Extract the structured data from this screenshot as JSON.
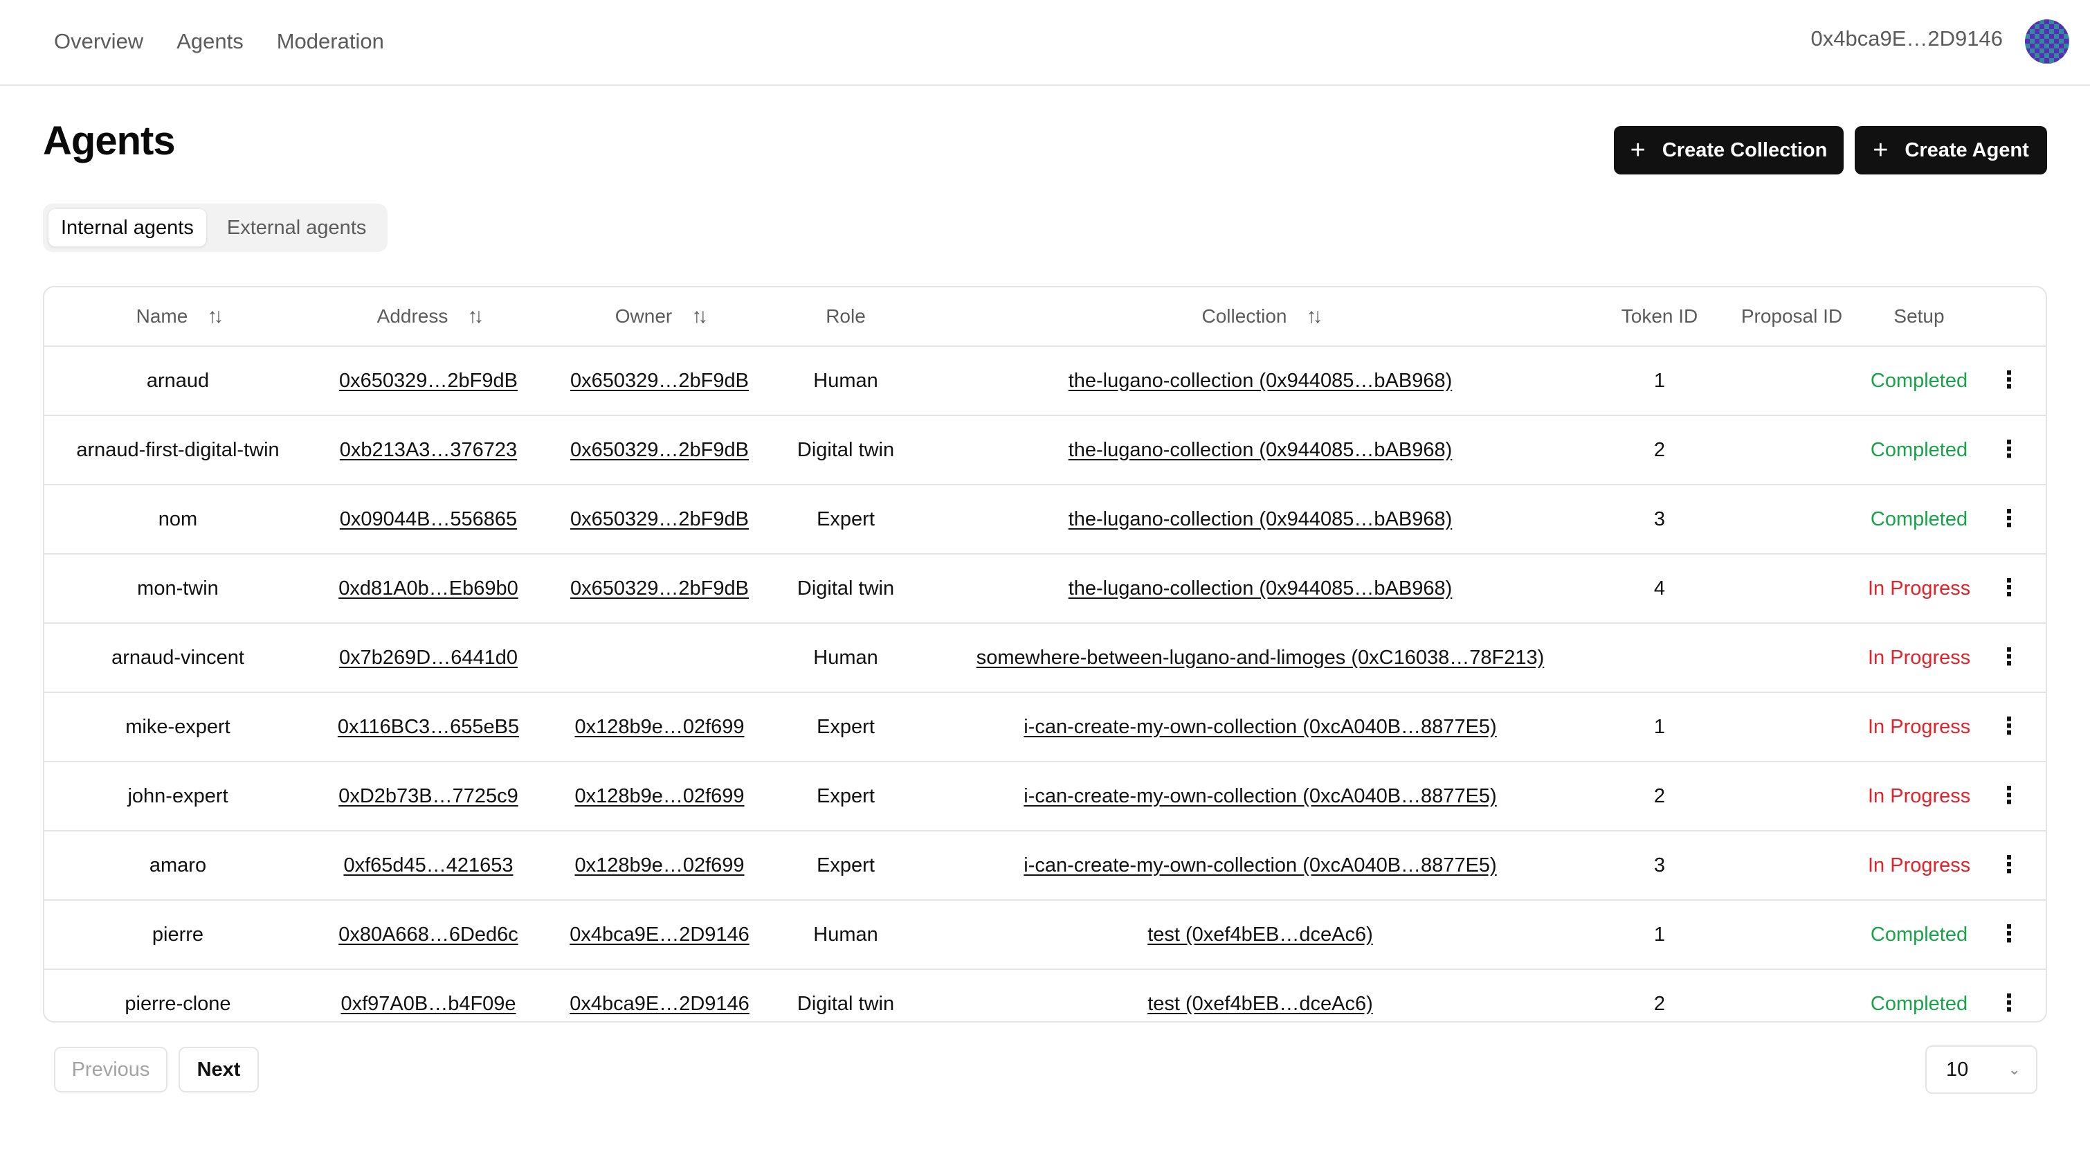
{
  "nav": {
    "items": [
      "Overview",
      "Agents",
      "Moderation"
    ]
  },
  "wallet": {
    "address": "0x4bca9E…2D9146"
  },
  "page": {
    "title": "Agents",
    "create_collection_label": "Create Collection",
    "create_agent_label": "Create Agent"
  },
  "tabs": {
    "internal": "Internal agents",
    "external": "External agents",
    "active": "Internal agents"
  },
  "table": {
    "columns": [
      "Name",
      "Address",
      "Owner",
      "Role",
      "Collection",
      "Token ID",
      "Proposal ID",
      "Setup"
    ],
    "sortable_columns": [
      "Name",
      "Address",
      "Owner",
      "Collection"
    ],
    "rows": [
      {
        "name": "arnaud",
        "address": "0x650329…2bF9dB",
        "owner": "0x650329…2bF9dB",
        "role": "Human",
        "collection": "the-lugano-collection (0x944085…bAB968)",
        "token_id": "1",
        "proposal_id": "",
        "setup": "Completed"
      },
      {
        "name": "arnaud-first-digital-twin",
        "address": "0xb213A3…376723",
        "owner": "0x650329…2bF9dB",
        "role": "Digital twin",
        "collection": "the-lugano-collection (0x944085…bAB968)",
        "token_id": "2",
        "proposal_id": "",
        "setup": "Completed"
      },
      {
        "name": "nom",
        "address": "0x09044B…556865",
        "owner": "0x650329…2bF9dB",
        "role": "Expert",
        "collection": "the-lugano-collection (0x944085…bAB968)",
        "token_id": "3",
        "proposal_id": "",
        "setup": "Completed"
      },
      {
        "name": "mon-twin",
        "address": "0xd81A0b…Eb69b0",
        "owner": "0x650329…2bF9dB",
        "role": "Digital twin",
        "collection": "the-lugano-collection (0x944085…bAB968)",
        "token_id": "4",
        "proposal_id": "",
        "setup": "In Progress"
      },
      {
        "name": "arnaud-vincent",
        "address": "0x7b269D…6441d0",
        "owner": "",
        "role": "Human",
        "collection": "somewhere-between-lugano-and-limoges (0xC16038…78F213)",
        "token_id": "",
        "proposal_id": "",
        "setup": "In Progress"
      },
      {
        "name": "mike-expert",
        "address": "0x116BC3…655eB5",
        "owner": "0x128b9e…02f699",
        "role": "Expert",
        "collection": "i-can-create-my-own-collection (0xcA040B…8877E5)",
        "token_id": "1",
        "proposal_id": "",
        "setup": "In Progress"
      },
      {
        "name": "john-expert",
        "address": "0xD2b73B…7725c9",
        "owner": "0x128b9e…02f699",
        "role": "Expert",
        "collection": "i-can-create-my-own-collection (0xcA040B…8877E5)",
        "token_id": "2",
        "proposal_id": "",
        "setup": "In Progress"
      },
      {
        "name": "amaro",
        "address": "0xf65d45…421653",
        "owner": "0x128b9e…02f699",
        "role": "Expert",
        "collection": "i-can-create-my-own-collection (0xcA040B…8877E5)",
        "token_id": "3",
        "proposal_id": "",
        "setup": "In Progress"
      },
      {
        "name": "pierre",
        "address": "0x80A668…6Ded6c",
        "owner": "0x4bca9E…2D9146",
        "role": "Human",
        "collection": "test (0xef4bEB…dceAc6)",
        "token_id": "1",
        "proposal_id": "",
        "setup": "Completed"
      },
      {
        "name": "pierre-clone",
        "address": "0xf97A0B…b4F09e",
        "owner": "0x4bca9E…2D9146",
        "role": "Digital twin",
        "collection": "test (0xef4bEB…dceAc6)",
        "token_id": "2",
        "proposal_id": "",
        "setup": "Completed"
      }
    ]
  },
  "pagination": {
    "previous_label": "Previous",
    "next_label": "Next",
    "page_size": "10"
  },
  "colors": {
    "completed": "#18a34a",
    "in_progress": "#e0242b",
    "primary_button": "#111111"
  },
  "icons": {
    "plus": "plus-icon",
    "sort": "sort-icon",
    "more": "more-vertical-icon",
    "chevron": "chevron-down-icon"
  }
}
